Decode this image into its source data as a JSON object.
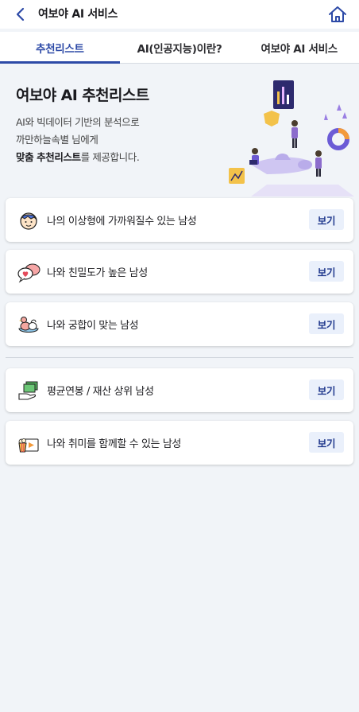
{
  "header": {
    "title": "여보야 AI 서비스",
    "back_icon": "chevron-left-icon",
    "home_icon": "home-icon",
    "accent": "#2d4aa7"
  },
  "tabs": [
    {
      "label": "추천리스트",
      "active": true
    },
    {
      "label": "AI(인공지능)이란?",
      "active": false
    },
    {
      "label": "여보야 AI 서비스",
      "active": false
    }
  ],
  "hero": {
    "title": "여보야 AI 추천리스트",
    "line1": "AI와 빅데이터 기반의 분석으로",
    "line2": "까만하늘속별 님에게",
    "line3_bold": "맞춤 추천리스트",
    "line3_rest": "를 제공합니다."
  },
  "cards": [
    {
      "label": "나의 이상형에 가까워질수 있는 남성",
      "button": "보기",
      "icon": "boy-face-icon"
    },
    {
      "label": "나와 친밀도가 높은 남성",
      "button": "보기",
      "icon": "chat-heart-icon"
    },
    {
      "label": "나와 궁합이 맞는 남성",
      "button": "보기",
      "icon": "couple-bird-icon"
    },
    {
      "label": "평균연봉 / 재산 상위 남성",
      "button": "보기",
      "icon": "money-hand-icon"
    },
    {
      "label": "나와 취미를 함께할 수 있는 남성",
      "button": "보기",
      "icon": "popcorn-movie-icon"
    }
  ]
}
